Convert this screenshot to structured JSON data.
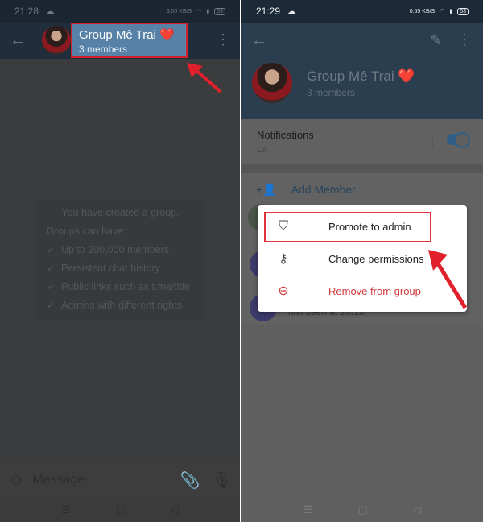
{
  "left": {
    "status": {
      "time": "21:28",
      "speed": "3.00 KB/S",
      "battery": "53"
    },
    "header": {
      "title": "Group Mê Trai ❤️",
      "subtitle": "3 members"
    },
    "info": {
      "heading": "You have created a group.",
      "subheading": "Groups can have:",
      "features": [
        "Up to 200,000 members",
        "Persistent chat history",
        "Public links such as t.me/title",
        "Admins with different rights"
      ]
    },
    "input": {
      "placeholder": "Message"
    }
  },
  "right": {
    "status": {
      "time": "21:29",
      "speed": "0.55 KB/S",
      "battery": "53"
    },
    "profile": {
      "title": "Group Mê Trai ❤️",
      "subtitle": "3 members"
    },
    "notifications": {
      "label": "Notifications",
      "value": "On",
      "enabled": true
    },
    "add_member": "Add Member",
    "member_last_seen": "last seen at 20:18",
    "menu": [
      {
        "label": "Promote to admin",
        "icon": "shield-star-icon"
      },
      {
        "label": "Change permissions",
        "icon": "key-icon"
      },
      {
        "label": "Remove from group",
        "icon": "minus-circle-icon"
      }
    ]
  },
  "colors": {
    "highlight": "#e0343a",
    "accent": "#5781a6",
    "danger": "#d13b3b"
  }
}
